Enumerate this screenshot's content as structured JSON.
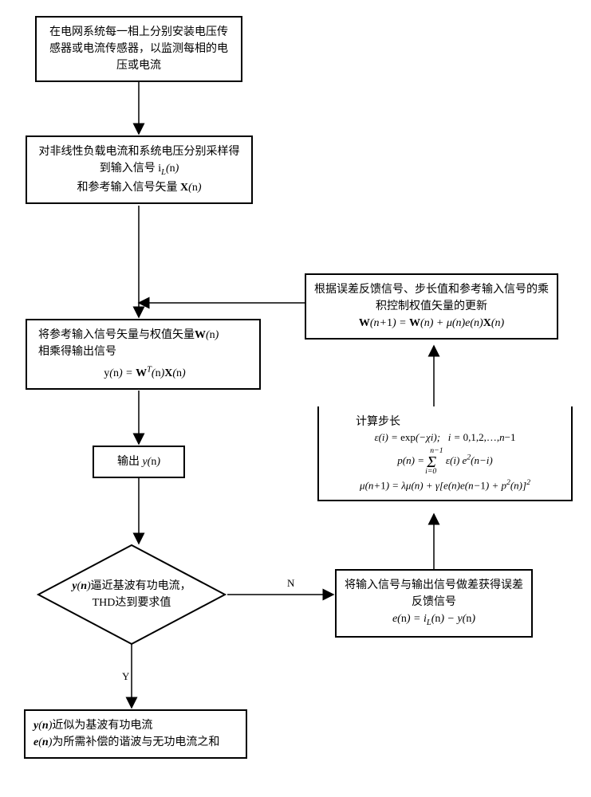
{
  "flowchart": {
    "steps": {
      "s1": {
        "text": "在电网系统每一相上分别安装电压传感器或电流传感器，以监测每相的电压或电流"
      },
      "s2": {
        "line1": "对非线性负载电流和系统电压分别采样得到输入信号",
        "sig1": "iL(n)",
        "line2": "和参考输入信号矢量",
        "sig2": "X(n)"
      },
      "s3": {
        "line1_a": "将参考输入信号矢量与权值矢量",
        "line1_w": "W(n)",
        "line2": "相乘得输出信号",
        "formula": "y(n) = Wᵀ(n)X(n)"
      },
      "s4": {
        "text": "输出",
        "var": "y(n)"
      },
      "s5_diamond": {
        "line1_a": "y(n)",
        "line1_b": "逼近基波有功电流，",
        "line2": "THD达到要求值"
      },
      "s6": {
        "line1_a": "y(n)",
        "line1_b": "近似为基波有功电流",
        "line2_a": "e(n)",
        "line2_b": "为所需补偿的谐波与无功电流之和"
      },
      "s7_error": {
        "line1": "将输入信号与输出信号做差获得误差反馈信号",
        "formula": "e(n) = iL(n) − y(n)"
      },
      "s8_step": {
        "title": "计算步长",
        "f1": "ε(i) = exp(−χi);   i = 0,1,2,…,n−1",
        "f2": "p(n) = Σ_{i=0}^{n−1} ε(i) e²(n−i)",
        "f3": "μ(n+1) = λμ(n) + γ[e(n)e(n−1) + p²(n)]²"
      },
      "s9_update": {
        "line1": "根据误差反馈信号、步长值和参考输入信号的乘积控制权值矢量的更新",
        "formula": "W(n+1) = W(n) + μ(n)e(n)X(n)"
      }
    },
    "edges": {
      "no": "N",
      "yes": "Y"
    }
  }
}
